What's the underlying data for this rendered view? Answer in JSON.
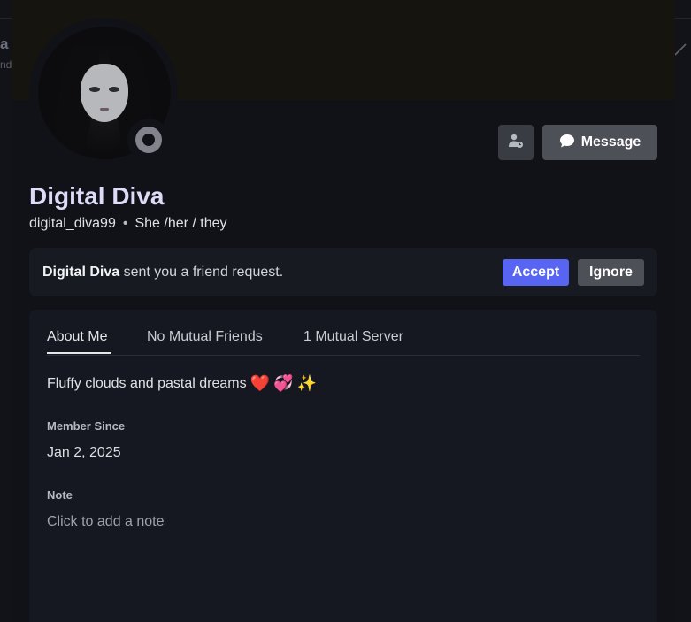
{
  "background": {
    "left_text": "a",
    "left_text2": "nd",
    "right_icon": "pencil-icon"
  },
  "profile": {
    "display_name": "Digital Diva",
    "username": "digital_diva99",
    "separator": "•",
    "pronouns": "She /her / they",
    "status": "offline"
  },
  "actions": {
    "message_label": "Message",
    "friend_icon": "user-pending-icon",
    "message_icon": "chat-bubble-icon"
  },
  "friend_request": {
    "name": "Digital Diva",
    "text": " sent you a friend request.",
    "accept_label": "Accept",
    "ignore_label": "Ignore"
  },
  "tabs": [
    {
      "label": "About Me",
      "active": true
    },
    {
      "label": "No Mutual Friends",
      "active": false
    },
    {
      "label": "1 Mutual Server",
      "active": false
    }
  ],
  "about": {
    "bio": "Fluffy clouds and pastal dreams",
    "emojis": [
      "❤️",
      "💞",
      "✨"
    ],
    "member_since_label": "Member Since",
    "member_since": "Jan 2, 2025",
    "note_label": "Note",
    "note_placeholder": "Click to add a note"
  },
  "colors": {
    "accent": "#5865f2",
    "button_gray": "#4e5058",
    "panel": "#161821",
    "modal": "#111218"
  }
}
